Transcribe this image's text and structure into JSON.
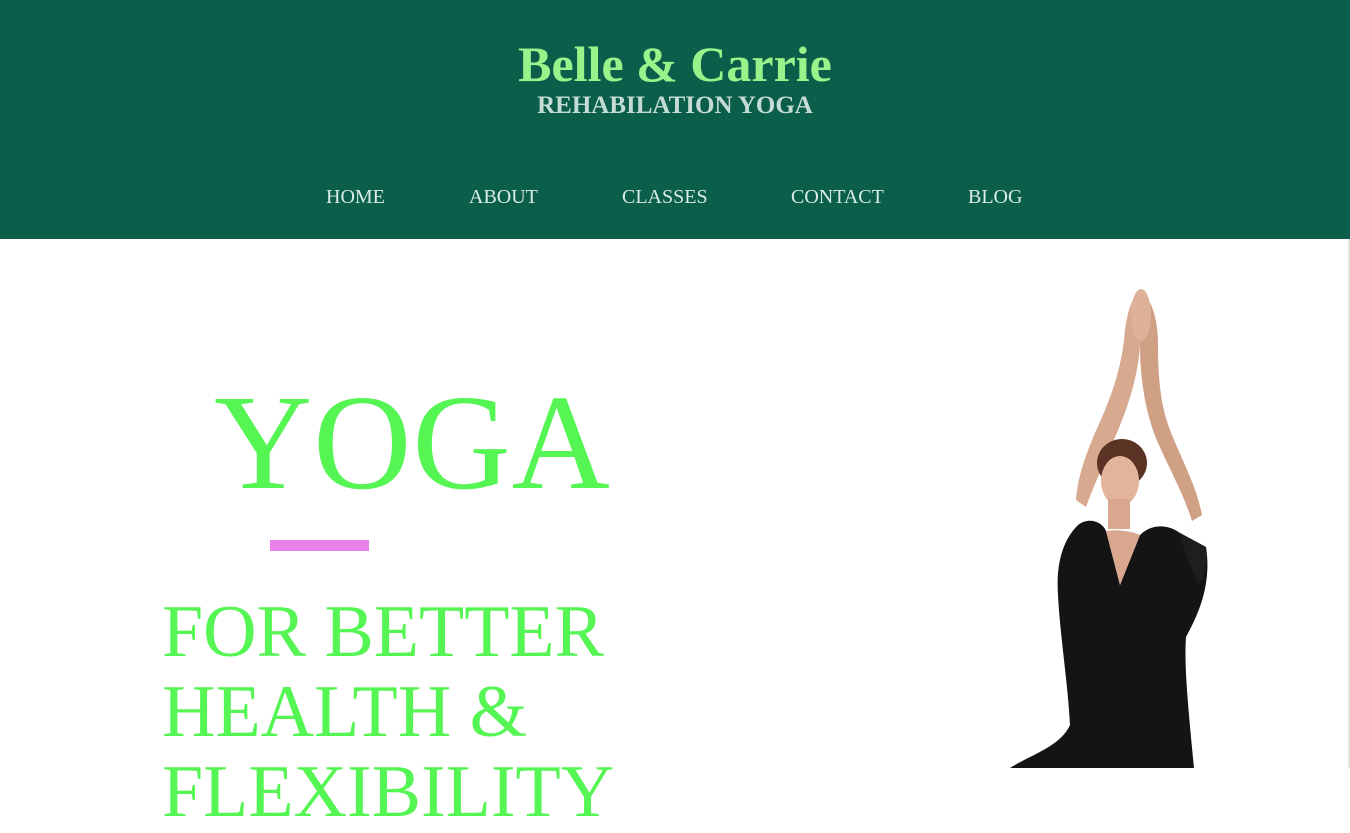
{
  "header": {
    "title": "Belle & Carrie",
    "subtitle": "REHABILATION YOGA"
  },
  "nav": {
    "items": [
      {
        "label": "HOME"
      },
      {
        "label": "ABOUT"
      },
      {
        "label": "CLASSES"
      },
      {
        "label": "CONTACT"
      },
      {
        "label": "BLOG"
      }
    ]
  },
  "hero": {
    "title": "YOGA",
    "tagline": "FOR BETTER HEALTH & FLEXIBILITY"
  },
  "colors": {
    "header_bg": "#0b5e49",
    "brand": "#98f38a",
    "hero_text": "#55f553",
    "accent": "#e882e8"
  }
}
